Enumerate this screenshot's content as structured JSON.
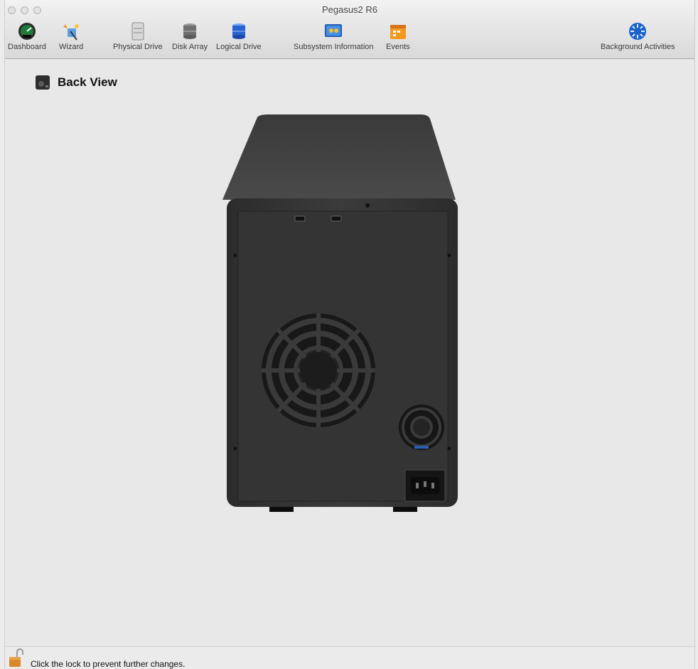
{
  "window": {
    "title": "Pegasus2 R6"
  },
  "toolbar": {
    "items": [
      {
        "label": "Dashboard",
        "icon": "dashboard-gauge-icon"
      },
      {
        "label": "Wizard",
        "icon": "wizard-icon"
      },
      {
        "label": "Physical Drive",
        "icon": "physical-drive-icon"
      },
      {
        "label": "Disk Array",
        "icon": "disk-array-icon"
      },
      {
        "label": "Logical Drive",
        "icon": "logical-drive-icon"
      },
      {
        "label": "Subsystem Information",
        "icon": "subsystem-information-icon"
      },
      {
        "label": "Events",
        "icon": "events-calendar-icon"
      },
      {
        "label": "Background Activities",
        "icon": "background-activities-icon"
      }
    ]
  },
  "main": {
    "heading": "Back View",
    "heading_icon": "device-back-icon"
  },
  "status": {
    "text": "Click the lock to prevent further changes.",
    "icon": "padlock-icon"
  }
}
